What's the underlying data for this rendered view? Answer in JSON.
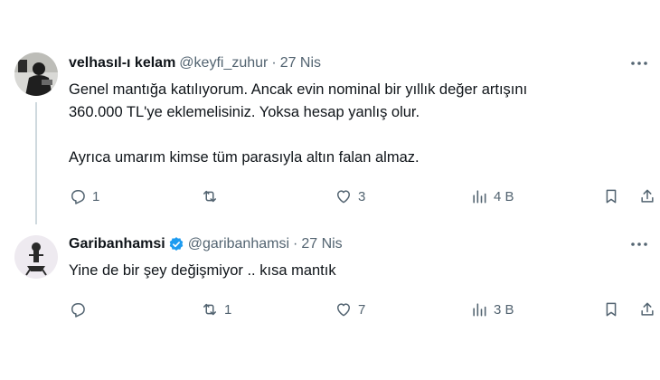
{
  "tweets": [
    {
      "display_name": "velhasıl-ı kelam",
      "handle": "@keyfi_zuhur",
      "dot": "·",
      "date": "27 Nis",
      "text": "Genel mantığa katılıyorum. Ancak evin nominal bir yıllık değer artışını\n360.000 TL'ye eklemelisiniz. Yoksa hesap yanlış olur.\n\nAyrıca umarım kimse tüm parasıyla altın falan almaz.",
      "replies": "1",
      "retweets": "",
      "likes": "3",
      "views": "4 B",
      "verified": false
    },
    {
      "display_name": "Garibanhamsi",
      "handle": "@garibanhamsi",
      "dot": "·",
      "date": "27 Nis",
      "text": "Yine de bir şey değişmiyor .. kısa mantık",
      "replies": "",
      "retweets": "1",
      "likes": "7",
      "views": "3 B",
      "verified": true
    }
  ],
  "icons": {
    "reply": "reply-icon",
    "retweet": "retweet-icon",
    "like": "like-icon",
    "views": "views-icon",
    "bookmark": "bookmark-icon",
    "share": "share-icon",
    "more": "more-icon",
    "verified": "verified-badge-icon"
  },
  "colors": {
    "verified": "#1d9bf0",
    "secondary_text": "#536471",
    "thread_line": "#cfd9de"
  }
}
